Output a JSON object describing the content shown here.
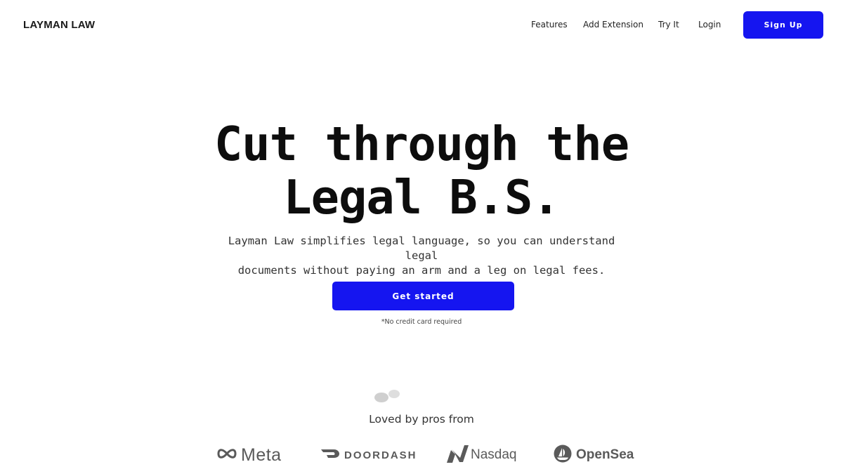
{
  "nav": {
    "brand": "LAYMAN LAW",
    "links": [
      {
        "label": "Features"
      },
      {
        "label": "Add Extension"
      },
      {
        "label": "Try It"
      },
      {
        "label": "Login"
      }
    ],
    "signup_label": "Sign Up"
  },
  "hero": {
    "title_line1": "Cut through the",
    "title_line2": "Legal B.S.",
    "subtitle_line1": "Layman Law simplifies legal language, so you can understand legal",
    "subtitle_line2": "documents without paying an arm and a leg on legal fees.",
    "cta_label": "Get started",
    "cta_note": "*No credit card required"
  },
  "social_proof": {
    "heading": "Loved by pros from",
    "logos": [
      {
        "name": "Meta",
        "icon": "meta-infinity-icon"
      },
      {
        "name": "DOORDASH",
        "icon": "doordash-icon"
      },
      {
        "name": "Nasdaq",
        "icon": "nasdaq-icon"
      },
      {
        "name": "OpenSea",
        "icon": "opensea-icon"
      }
    ]
  },
  "colors": {
    "accent": "#1515f0",
    "text": "#111111",
    "logo_gray": "#5a5a5a"
  }
}
